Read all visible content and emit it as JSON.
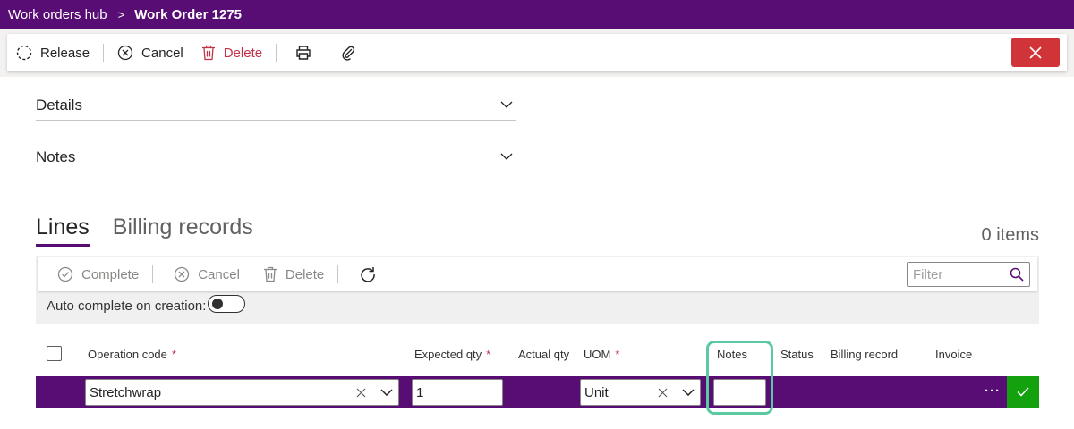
{
  "breadcrumb": {
    "parent": "Work orders hub",
    "separator": ">",
    "current": "Work Order 1275"
  },
  "toolbar": {
    "release": "Release",
    "cancel": "Cancel",
    "delete": "Delete"
  },
  "sections": {
    "details": "Details",
    "notes": "Notes"
  },
  "tabs": {
    "lines": "Lines",
    "billing": "Billing records",
    "count": "0 items"
  },
  "lines_toolbar": {
    "complete": "Complete",
    "cancel": "Cancel",
    "delete": "Delete",
    "filter_placeholder": "Filter"
  },
  "auto_complete": {
    "label": "Auto complete on creation:",
    "enabled": false
  },
  "columns": {
    "operation_code": "Operation code",
    "expected_qty": "Expected qty",
    "actual_qty": "Actual qty",
    "uom": "UOM",
    "notes": "Notes",
    "status": "Status",
    "billing_record": "Billing record",
    "invoice": "Invoice",
    "required_mark": "*"
  },
  "row": {
    "operation_code": "Stretchwrap",
    "expected_qty": "1",
    "uom": "Unit",
    "notes": "",
    "more": "···"
  },
  "colors": {
    "brand": "#570d73",
    "danger": "#d13438",
    "confirm": "#13a10e",
    "highlight": "#5cc9a0"
  }
}
